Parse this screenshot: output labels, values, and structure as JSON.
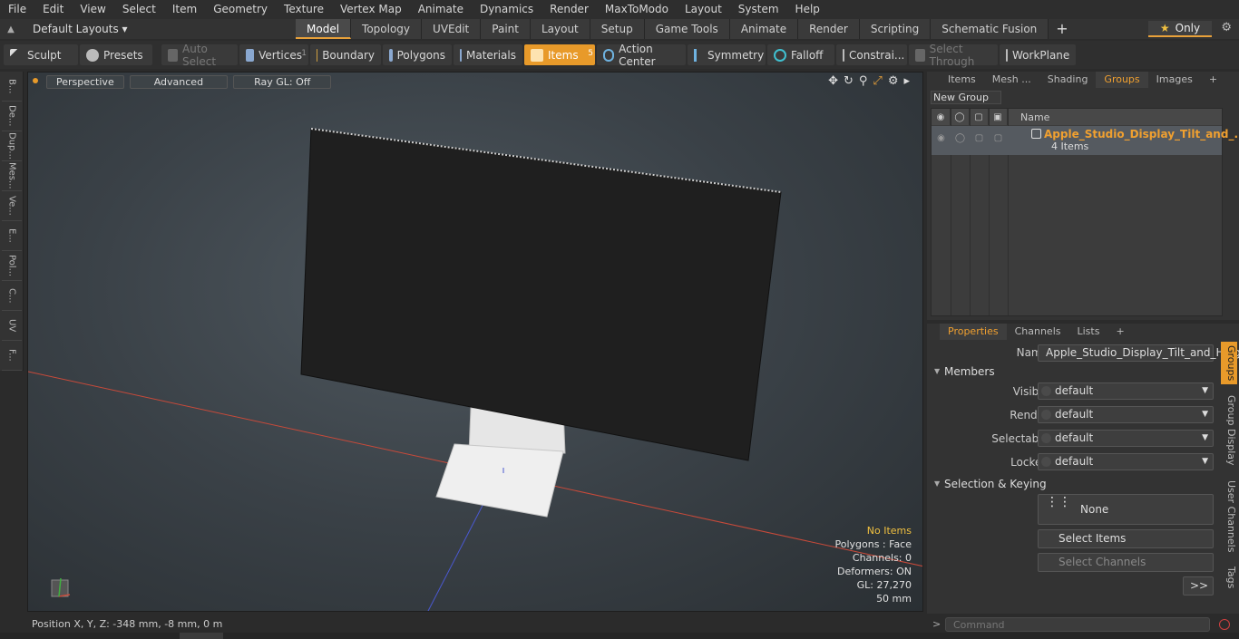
{
  "menu": [
    "File",
    "Edit",
    "View",
    "Select",
    "Item",
    "Geometry",
    "Texture",
    "Vertex Map",
    "Animate",
    "Dynamics",
    "Render",
    "MaxToModo",
    "Layout",
    "System",
    "Help"
  ],
  "layout": {
    "dropdown": "Default Layouts ▾",
    "tabs": [
      "Model",
      "Topology",
      "UVEdit",
      "Paint",
      "Layout",
      "Setup",
      "Game Tools",
      "Animate",
      "Render",
      "Scripting",
      "Schematic Fusion"
    ],
    "active_tab": "Model",
    "plus": "+",
    "only_label": "Only"
  },
  "toolbar": {
    "sculpt": "Sculpt",
    "presets": "Presets",
    "auto_select": "Auto Select",
    "vertices": "Vertices",
    "vertices_count": "1",
    "boundary": "Boundary",
    "polygons": "Polygons",
    "materials": "Materials",
    "items": "Items",
    "items_count": "5",
    "action_center": "Action Center",
    "symmetry": "Symmetry",
    "falloff": "Falloff",
    "constraints": "Constrai...",
    "select_through": "Select Through",
    "workplane": "WorkPlane"
  },
  "leftstrip": [
    "B...",
    "De...",
    "Dup...",
    "Mes...",
    "Ve...",
    "E...",
    "Pol...",
    "C...",
    "UV",
    "F..."
  ],
  "viewport": {
    "perspective": "Perspective",
    "advanced": "Advanced",
    "raygl": "Ray GL: Off",
    "info": {
      "no_items": "No Items",
      "polygons": "Polygons : Face",
      "channels": "Channels: 0",
      "deformers": "Deformers: ON",
      "gl": "GL: 27,270",
      "scale": "50 mm"
    }
  },
  "status": {
    "position": "Position X, Y, Z:  -348 mm, -8 mm, 0 m"
  },
  "right_top": {
    "tabs": [
      "Items",
      "Mesh ...",
      "Shading",
      "Groups",
      "Images"
    ],
    "active_tab": "Groups",
    "new_group": "New Group",
    "col_name": "Name",
    "group_name": "Apple_Studio_Display_Tilt_and_...",
    "group_count": "4 Items"
  },
  "properties": {
    "tabs": [
      "Properties",
      "Channels",
      "Lists"
    ],
    "active_tab": "Properties",
    "name_label": "Name",
    "name_value": "Apple_Studio_Display_Tilt_and_Heigh",
    "members_header": "Members",
    "visible_label": "Visible",
    "visible_value": "default",
    "render_label": "Render",
    "render_value": "default",
    "selectable_label": "Selectable",
    "selectable_value": "default",
    "locked_label": "Locked",
    "locked_value": "default",
    "sel_keying_header": "Selection & Keying",
    "none_btn": "None",
    "select_items": "Select Items",
    "select_channels": "Select Channels",
    "more": ">>",
    "vtabs": [
      "Groups",
      "Group Display",
      "User Channels",
      "Tags"
    ]
  },
  "command": {
    "prompt": ">",
    "placeholder": "Command"
  },
  "colors": {
    "accent": "#e89a2a",
    "group_name": "#f0a030"
  }
}
